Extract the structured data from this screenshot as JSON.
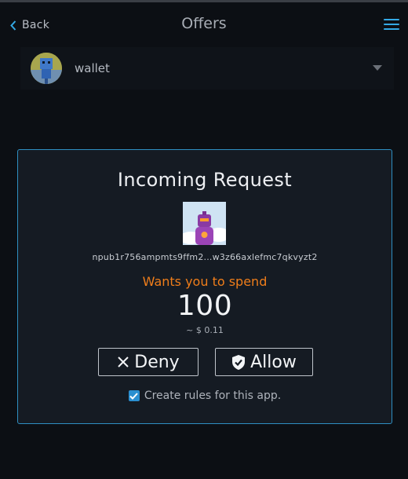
{
  "header": {
    "back_label": "Back",
    "title": "Offers"
  },
  "wallet": {
    "name": "wallet"
  },
  "request": {
    "title": "Incoming Request",
    "npub": "npub1r756ampmts9ffm2...w3z66axlefmc7qkvyzt2",
    "message": "Wants you to spend",
    "amount": "100",
    "fiat": "~ $ 0.11",
    "deny_label": "Deny",
    "allow_label": "Allow",
    "rules_label": "Create rules for this app.",
    "rules_checked": true
  },
  "colors": {
    "accent": "#2f8fc2",
    "warning": "#ef7d1a",
    "background": "#0c0f14",
    "card": "#151b23"
  }
}
